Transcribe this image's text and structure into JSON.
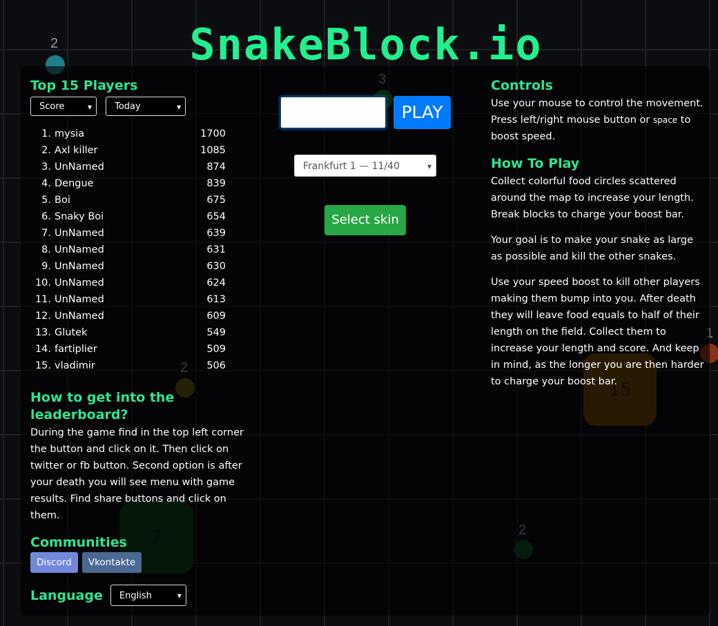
{
  "title": "SnakeBlock.io",
  "background_objects": {
    "food": [
      {
        "label": "2",
        "color": "#1f7f88"
      },
      {
        "label": "3",
        "color": "#1f6b2a"
      },
      {
        "label": "2",
        "color": "#6d6713"
      },
      {
        "label": "2",
        "color": "#0e4c22"
      },
      {
        "label": "1",
        "color": "#8b3213"
      }
    ],
    "blocks": [
      {
        "label": "7",
        "color": "#0b3d16"
      },
      {
        "label": "15",
        "color": "#6b4506"
      }
    ]
  },
  "leaderboard": {
    "heading": "Top 15 Players",
    "sort_select": "Score",
    "period_select": "Today",
    "rows": [
      {
        "rank": "1.",
        "name": "mysia",
        "score": "1700"
      },
      {
        "rank": "2.",
        "name": "Axl killer",
        "score": "1085"
      },
      {
        "rank": "3.",
        "name": "UnNamed",
        "score": "874"
      },
      {
        "rank": "4.",
        "name": "Dengue",
        "score": "839"
      },
      {
        "rank": "5.",
        "name": "Boi",
        "score": "675"
      },
      {
        "rank": "6.",
        "name": "Snaky Boi",
        "score": "654"
      },
      {
        "rank": "7.",
        "name": "UnNamed",
        "score": "639"
      },
      {
        "rank": "8.",
        "name": "UnNamed",
        "score": "631"
      },
      {
        "rank": "9.",
        "name": "UnNamed",
        "score": "630"
      },
      {
        "rank": "10.",
        "name": "UnNamed",
        "score": "624"
      },
      {
        "rank": "11.",
        "name": "UnNamed",
        "score": "613"
      },
      {
        "rank": "12.",
        "name": "UnNamed",
        "score": "609"
      },
      {
        "rank": "13.",
        "name": "Glutek",
        "score": "549"
      },
      {
        "rank": "14.",
        "name": "fartiplier",
        "score": "509"
      },
      {
        "rank": "15.",
        "name": "vladimir",
        "score": "506"
      }
    ]
  },
  "howto_leaderboard": {
    "heading": "How to get into the leaderboard?",
    "text": "During the game find in the top left corner the button and click on it. Then click on twitter or fb button. Second option is after your death you will see menu with game results. Find share buttons and click on them."
  },
  "communities": {
    "heading": "Communities",
    "discord": "Discord",
    "vkontakte": "Vkontakte"
  },
  "language": {
    "heading": "Language",
    "value": "English"
  },
  "center": {
    "nickname_value": "",
    "play": "PLAY",
    "server": "Frankfurt 1 — 11/40",
    "select_skin": "Select skin"
  },
  "controls": {
    "heading": "Controls",
    "line1": "Use your mouse to control the movement. Press left/right mouse button or ",
    "key": "space",
    "line2": " to boost speed."
  },
  "howtoplay": {
    "heading": "How To Play",
    "p1": "Collect colorful food circles scattered around the map to increase your length. Break blocks to charge your boost bar.",
    "p2": "Your goal is to make your snake as large as possible and kill the other snakes.",
    "p3": "Use your speed boost to kill other players making them bump into you. After death they will leave food equals to half of their length on the field. Collect them to increase your length and score. And keep in mind, as the longer you are then harder to charge your boost bar."
  },
  "colors": {
    "accent": "#2ee58e",
    "play": "#007bff",
    "skin": "#28a745",
    "discord": "#7289da",
    "vk": "#4a6a94"
  }
}
